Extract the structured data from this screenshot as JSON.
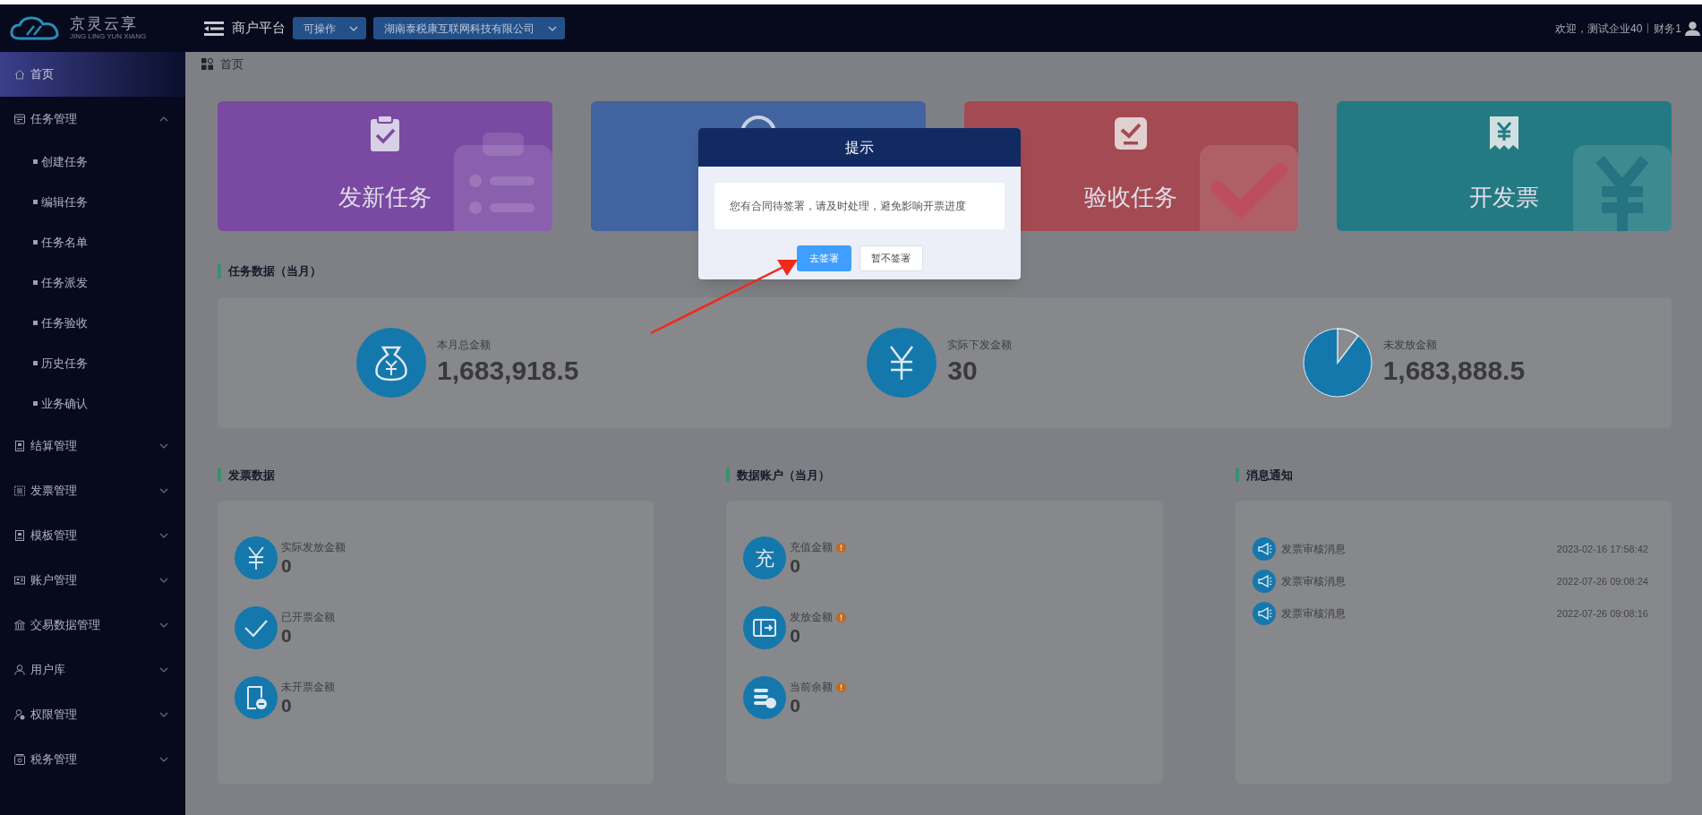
{
  "header": {
    "logo_text": "京灵云享",
    "logo_subtitle": "JING LING YUN XIANG",
    "platform_title": "商户平台",
    "dropdowns": [
      {
        "label": "可操作"
      },
      {
        "label": "湖南泰税康互联网科技有限公司"
      }
    ],
    "welcome": "欢迎，测试企业40",
    "role": "财务1"
  },
  "sidebar": {
    "items": [
      {
        "label": "首页",
        "selected": true
      },
      {
        "label": "任务管理",
        "selected": false,
        "expanded": true,
        "children": [
          {
            "label": "创建任务",
            "selected": false
          },
          {
            "label": "编辑任务",
            "selected": false
          },
          {
            "label": "任务名单",
            "selected": false
          },
          {
            "label": "任务派发",
            "selected": false
          },
          {
            "label": "任务验收",
            "selected": false
          },
          {
            "label": "历史任务",
            "selected": false
          },
          {
            "label": "业务确认",
            "selected": false
          }
        ]
      },
      {
        "label": "结算管理",
        "selected": false,
        "expanded": false
      },
      {
        "label": "发票管理",
        "selected": false,
        "expanded": false
      },
      {
        "label": "模板管理",
        "selected": false,
        "expanded": false
      },
      {
        "label": "账户管理",
        "selected": false,
        "expanded": false
      },
      {
        "label": "交易数据管理",
        "selected": false,
        "expanded": false
      },
      {
        "label": "用户库",
        "selected": false,
        "expanded": false
      },
      {
        "label": "权限管理",
        "selected": false,
        "expanded": false
      },
      {
        "label": "税务管理",
        "selected": false,
        "expanded": false
      }
    ]
  },
  "breadcrumb": "首页",
  "quick_cards": [
    {
      "label": "发新任务",
      "color": "#7a4aa3"
    },
    {
      "color": "#41639f"
    },
    {
      "label": "验收任务",
      "color": "#a44a52"
    },
    {
      "label": "开发票",
      "color": "#237a82"
    }
  ],
  "task_stats": {
    "title": "任务数据（当月）",
    "items": [
      {
        "label": "本月总金额",
        "value": "1,683,918.5"
      },
      {
        "label": "实际下发金额",
        "value": "30"
      },
      {
        "label": "未发放金额",
        "value": "1,683,888.5"
      }
    ]
  },
  "invoice_data": {
    "title": "发票数据",
    "items": [
      {
        "label": "实际发放金额",
        "value": "0"
      },
      {
        "label": "已开票金额",
        "value": "0"
      },
      {
        "label": "未开票金额",
        "value": "0"
      }
    ]
  },
  "account_data": {
    "title": "数据账户（当月）",
    "items": [
      {
        "label": "充值金额",
        "value": "0",
        "icon_char": "充"
      },
      {
        "label": "发放金额",
        "value": "0"
      },
      {
        "label": "当前余额",
        "value": "0"
      }
    ]
  },
  "notices": {
    "title": "消息通知",
    "items": [
      {
        "title": "发票审核消息",
        "time": "2023-02-16 17:58:42"
      },
      {
        "title": "发票审核消息",
        "time": "2022-07-26 09:08:24"
      },
      {
        "title": "发票审核消息",
        "time": "2022-07-26 09:08:16"
      }
    ]
  },
  "modal": {
    "title": "提示",
    "message": "您有合同待签署，请及时处理，避免影响开票进度",
    "buttons": [
      {
        "label": "去签署",
        "kind": "primary"
      },
      {
        "label": "暂不签署",
        "kind": "default"
      }
    ]
  }
}
